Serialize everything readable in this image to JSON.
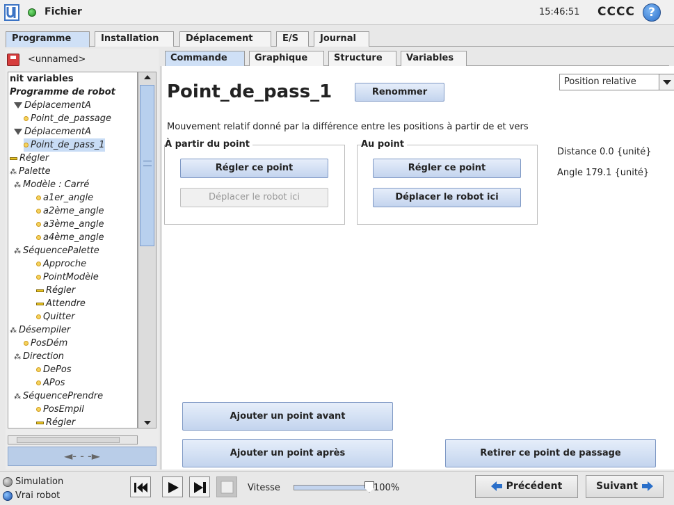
{
  "titlebar": {
    "menu": "Fichier",
    "clock": "15:46:51",
    "robot_name": "CCCC",
    "help": "?"
  },
  "top_tabs": [
    "Programme",
    "Installation",
    "Déplacement",
    "E/S",
    "Journal"
  ],
  "program": {
    "name": "<unnamed>"
  },
  "tree": [
    {
      "label": "nit variables",
      "style": "bold",
      "icon": "",
      "indent": 0
    },
    {
      "label": "Programme de robot",
      "style": "bold-italic",
      "icon": "",
      "indent": 0
    },
    {
      "label": "DéplacementA",
      "style": "italic",
      "icon": "move-icon",
      "indent": 1
    },
    {
      "label": "Point_de_passage",
      "style": "italic",
      "icon": "waypoint-icon",
      "indent": 2
    },
    {
      "label": "DéplacementA",
      "style": "italic",
      "icon": "move-icon",
      "indent": 1
    },
    {
      "label": "Point_de_pass_1",
      "style": "italic",
      "icon": "waypoint-icon",
      "indent": 2,
      "selected": true
    },
    {
      "label": "Régler",
      "style": "italic",
      "icon": "set-icon",
      "indent": 0
    },
    {
      "label": "Palette",
      "style": "italic",
      "icon": "pallet-icon",
      "indent": 0
    },
    {
      "label": "Modèle : Carré",
      "style": "italic",
      "icon": "pattern-icon",
      "indent": 1
    },
    {
      "label": "a1er_angle",
      "style": "italic",
      "icon": "waypoint-icon",
      "indent": 3
    },
    {
      "label": "a2ème_angle",
      "style": "italic",
      "icon": "waypoint-icon",
      "indent": 3
    },
    {
      "label": "a3ème_angle",
      "style": "italic",
      "icon": "waypoint-icon",
      "indent": 3
    },
    {
      "label": "a4ème_angle",
      "style": "italic",
      "icon": "waypoint-icon",
      "indent": 3
    },
    {
      "label": "SéquencePalette",
      "style": "italic",
      "icon": "sequence-icon",
      "indent": 1
    },
    {
      "label": "Approche",
      "style": "italic",
      "icon": "waypoint-icon",
      "indent": 3
    },
    {
      "label": "PointModèle",
      "style": "italic",
      "icon": "waypoint-icon",
      "indent": 3
    },
    {
      "label": "Régler",
      "style": "italic",
      "icon": "set-icon",
      "indent": 3
    },
    {
      "label": "Attendre",
      "style": "italic",
      "icon": "set-icon",
      "indent": 3
    },
    {
      "label": "Quitter",
      "style": "italic",
      "icon": "waypoint-icon",
      "indent": 3
    },
    {
      "label": "Désempiler",
      "style": "italic",
      "icon": "pallet-icon",
      "indent": 0
    },
    {
      "label": "PosDém",
      "style": "italic",
      "icon": "waypoint-icon",
      "indent": 2
    },
    {
      "label": "Direction",
      "style": "italic",
      "icon": "sequence-icon",
      "indent": 1
    },
    {
      "label": "DePos",
      "style": "italic",
      "icon": "waypoint-icon",
      "indent": 3
    },
    {
      "label": "APos",
      "style": "italic",
      "icon": "waypoint-icon",
      "indent": 3
    },
    {
      "label": "SéquencePrendre",
      "style": "italic",
      "icon": "sequence-icon",
      "indent": 1
    },
    {
      "label": "PosEmpil",
      "style": "italic",
      "icon": "waypoint-icon",
      "indent": 3
    },
    {
      "label": "Régler",
      "style": "italic",
      "icon": "set-icon",
      "indent": 3
    }
  ],
  "sub_tabs": [
    "Commande",
    "Graphique",
    "Structure",
    "Variables"
  ],
  "waypoint": {
    "title": "Point_de_pass_1",
    "rename_label": "Renommer",
    "type_select": "Position relative",
    "description": "Mouvement relatif donné par la différence entre les positions à partir de et vers",
    "from_group": {
      "title": "À partir du point",
      "set_label": "Régler ce point",
      "move_label": "Déplacer le robot ici"
    },
    "to_group": {
      "title": "Au point",
      "set_label": "Régler ce point",
      "move_label": "Déplacer le robot ici"
    },
    "distance": "Distance 0.0 {unité}",
    "angle": "Angle 179.1 {unité}",
    "add_before_label": "Ajouter un point avant",
    "add_after_label": "Ajouter un point après",
    "remove_label": "Retirer ce point de passage"
  },
  "bottom": {
    "simulation_label": "Simulation",
    "real_robot_label": "Vrai robot",
    "speed_label": "Vitesse",
    "speed_value": "100%",
    "speed_fraction": 1.0,
    "prev_label": "Précédent",
    "next_label": "Suivant"
  },
  "colors": {
    "accent": "#2a6fc9",
    "selection": "#c8dcf5",
    "button": "#c3d4ee",
    "status_green": "#1e8a1e"
  }
}
